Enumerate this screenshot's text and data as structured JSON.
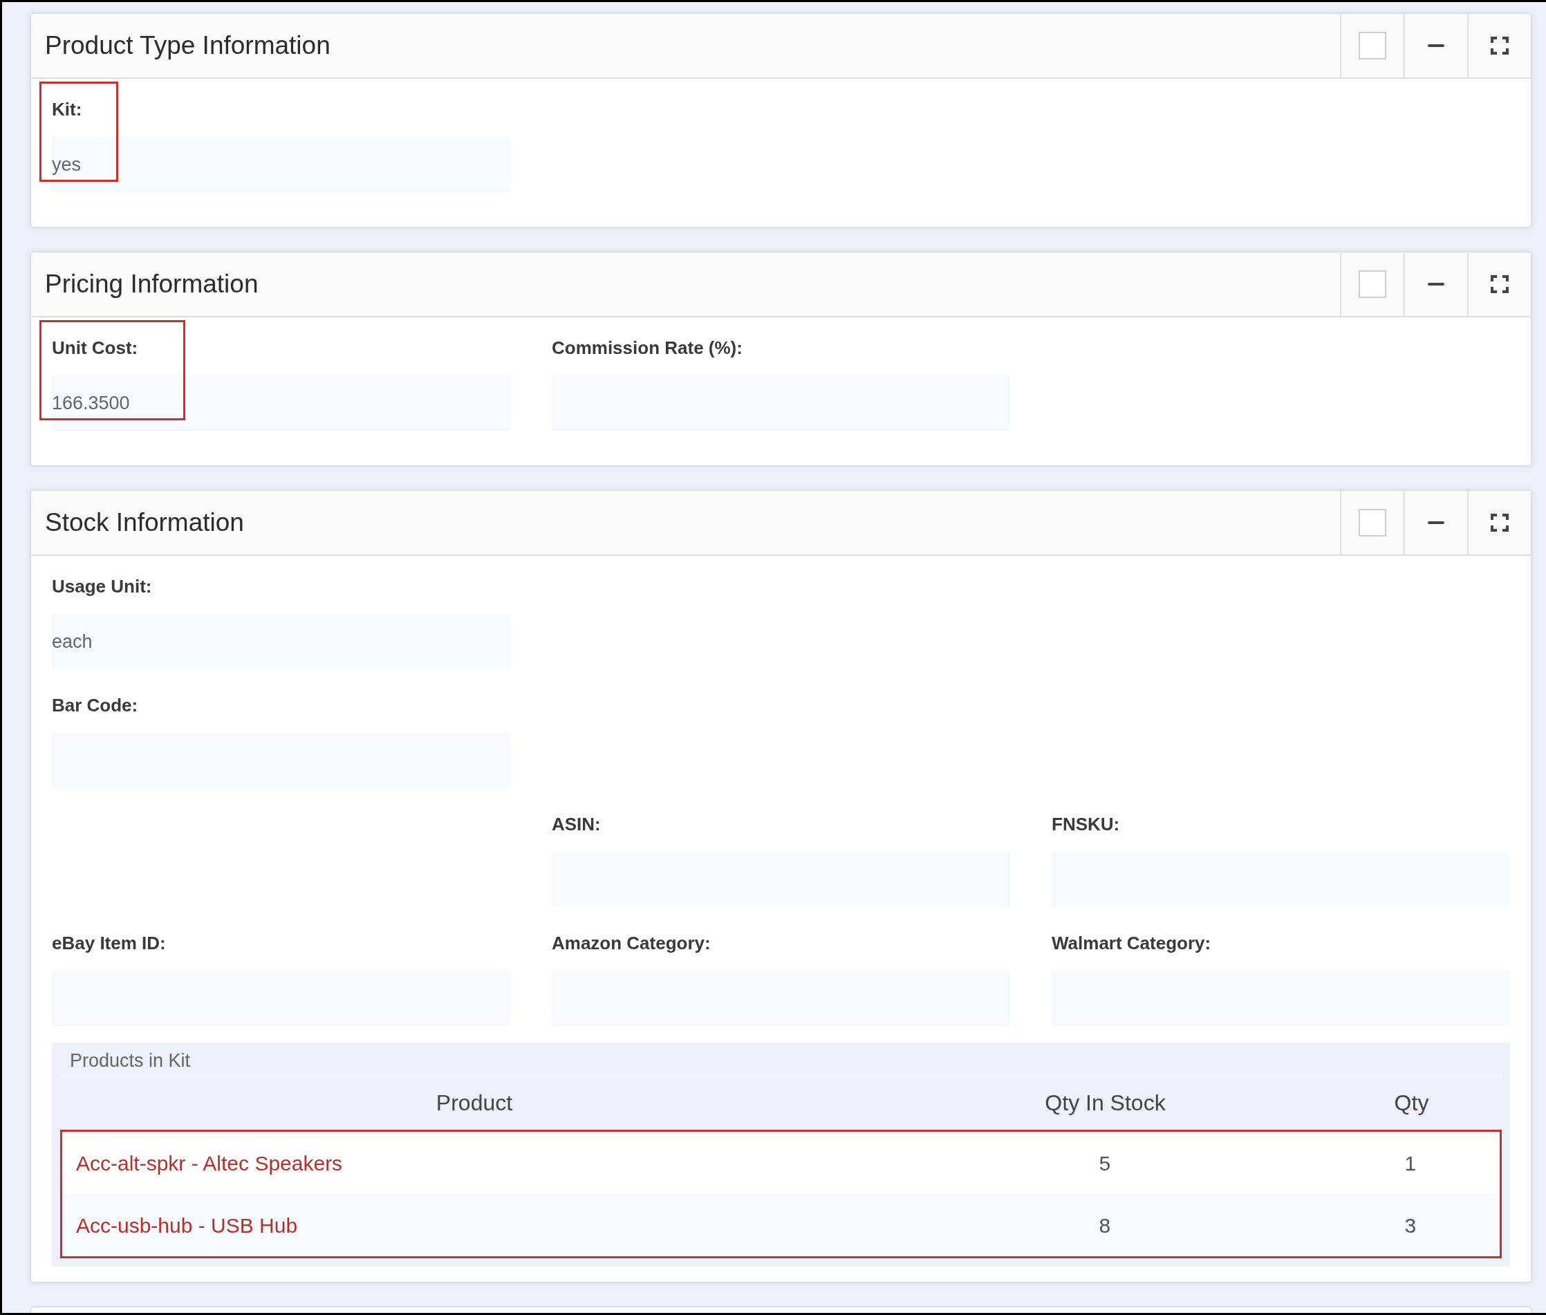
{
  "cards": [
    {
      "title": "Product Type Information",
      "checked": false,
      "rows": [
        {
          "indent": false,
          "fields": [
            {
              "label": "Kit:",
              "value": "yes",
              "highlighted": true
            }
          ]
        }
      ]
    },
    {
      "title": "Pricing Information",
      "checked": false,
      "rows": [
        {
          "indent": false,
          "fields": [
            {
              "label": "Unit Cost:",
              "value": "166.3500",
              "highlighted": true
            },
            {
              "label": "Commission Rate (%):",
              "highlighted": false
            }
          ]
        }
      ]
    },
    {
      "title": "Stock Information",
      "checked": false,
      "rows": [
        {
          "indent": false,
          "fields": [
            {
              "label": "Usage Unit:",
              "value": "each",
              "highlighted": false
            }
          ]
        },
        {
          "indent": false,
          "fields": [
            {
              "label": "Bar Code:",
              "highlighted": false
            }
          ]
        },
        {
          "indent": true,
          "fields": [
            {
              "label": "ASIN:",
              "highlighted": false
            },
            {
              "label": "FNSKU:",
              "highlighted": false
            }
          ]
        },
        {
          "indent": false,
          "fields": [
            {
              "label": "eBay Item ID:",
              "highlighted": false
            },
            {
              "label": "Amazon Category:",
              "highlighted": false
            },
            {
              "label": "Walmart Category:",
              "highlighted": false
            }
          ]
        }
      ],
      "kit_table": {
        "caption": "Products in Kit",
        "columns": [
          "Product",
          "Qty In Stock",
          "Qty"
        ],
        "rows_highlighted": true,
        "rows": [
          {
            "product": "Acc-alt-spkr - Altec Speakers",
            "qty_in_stock": "5",
            "qty": "1"
          },
          {
            "product": "Acc-usb-hub - USB Hub",
            "qty_in_stock": "8",
            "qty": "3"
          }
        ]
      }
    }
  ]
}
